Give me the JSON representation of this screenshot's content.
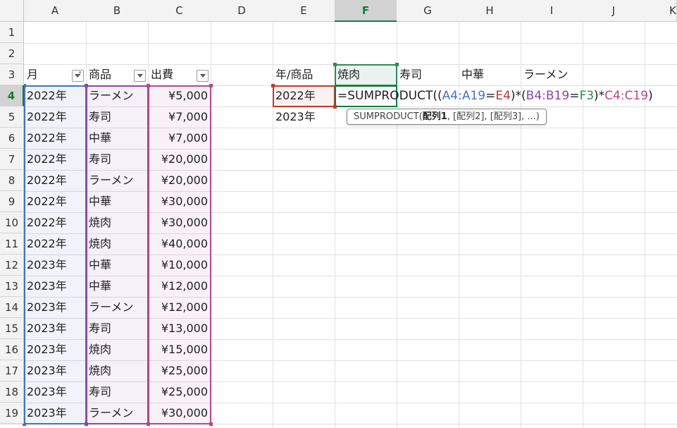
{
  "columns": [
    "",
    "A",
    "B",
    "C",
    "D",
    "E",
    "F",
    "G",
    "H",
    "I",
    "J",
    "K"
  ],
  "rows": [
    "1",
    "2",
    "3",
    "4",
    "5",
    "6",
    "7",
    "8",
    "9",
    "10",
    "11",
    "12",
    "13",
    "14",
    "15",
    "16",
    "17",
    "18",
    "19"
  ],
  "table": {
    "headers": [
      "月",
      "商品",
      "出費"
    ],
    "rows": [
      [
        "2022年",
        "ラーメン",
        "¥5,000"
      ],
      [
        "2022年",
        "寿司",
        "¥7,000"
      ],
      [
        "2022年",
        "中華",
        "¥7,000"
      ],
      [
        "2022年",
        "寿司",
        "¥20,000"
      ],
      [
        "2022年",
        "ラーメン",
        "¥20,000"
      ],
      [
        "2022年",
        "中華",
        "¥30,000"
      ],
      [
        "2022年",
        "焼肉",
        "¥30,000"
      ],
      [
        "2022年",
        "焼肉",
        "¥40,000"
      ],
      [
        "2023年",
        "中華",
        "¥10,000"
      ],
      [
        "2023年",
        "中華",
        "¥12,000"
      ],
      [
        "2023年",
        "ラーメン",
        "¥12,000"
      ],
      [
        "2023年",
        "寿司",
        "¥13,000"
      ],
      [
        "2023年",
        "焼肉",
        "¥15,000"
      ],
      [
        "2023年",
        "焼肉",
        "¥25,000"
      ],
      [
        "2023年",
        "寿司",
        "¥25,000"
      ],
      [
        "2023年",
        "ラーメン",
        "¥30,000"
      ]
    ]
  },
  "summary": {
    "corner": "年/商品",
    "products": [
      "焼肉",
      "寿司",
      "中華",
      "ラーメン"
    ],
    "years": [
      "2022年",
      "2023年"
    ]
  },
  "formula": {
    "eq": "=SUMPRODUCT(",
    "p1": "(",
    "r1": "A4:A19",
    "op1": "=",
    "r2": "E4",
    "p2": ")*(",
    "r3": "B4:B19",
    "op2": "=",
    "r4": "F3",
    "p3": ")*",
    "r5": "C4:C19",
    "p4": ")"
  },
  "tooltip": {
    "func": "SUMPRODUCT(",
    "arg1": "配列1",
    "rest": ", [配列2], [配列3], ...)"
  },
  "active_cell": "F4",
  "colors": {
    "selected_green": "#107c41",
    "range_a": "#4472c4",
    "range_b": "#8e44ad",
    "range_c": "#b5478e",
    "range_e": "#c0392b",
    "range_f": "#2e8b57"
  }
}
